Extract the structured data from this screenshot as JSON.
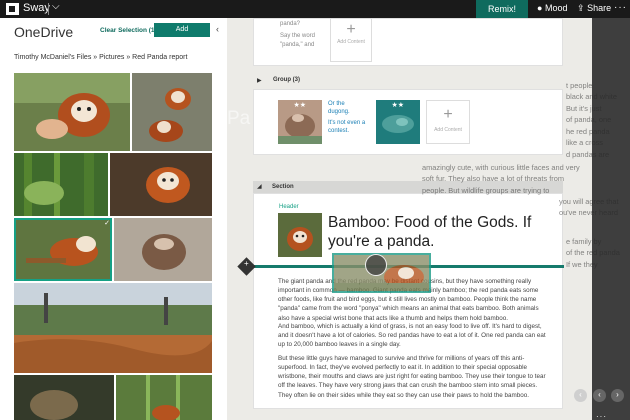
{
  "topbar": {
    "app_name": "Sway",
    "remix_label": "Remix!",
    "mood_label": "Mood",
    "share_label": "Share"
  },
  "onedrive": {
    "title": "OneDrive",
    "clear_selection": "Clear Selection (1)",
    "add_label": "Add",
    "breadcrumb": "Timothy McDaniel's Files » Pictures » Red Panda report"
  },
  "canvas": {
    "bg_text": "Pa",
    "prev_card_text_line1": "panda?",
    "prev_card_text_line2": "Say the word",
    "prev_card_text_line3": "\"panda,\" and",
    "add_content_label": "Add Content",
    "group_label": "Group (3)",
    "group_note_line1": "Or the",
    "group_note_line2": "dugong.",
    "group_note_line3": "It's not even a",
    "group_note_line4": "contest.",
    "section_label": "Section",
    "header_label": "Header",
    "heading": "Bamboo: Food of the Gods. If you're a panda.",
    "para1": "The giant panda and the red panda may be distant cousins, but they have something really important in common — bamboo. Giant panda eats mainly bamboo; the red panda eats some other foods, like fruit and bird eggs, but it still lives mostly on bamboo. People think the name \"panda\" came from the word \"ponya\" which means an animal that eats bamboo. Both animals also have a special wrist bone that acts like a thumb and helps them hold bamboo.",
    "para2": "And bamboo, which is actually a kind of grass, is not an easy food to live off. It's hard to digest, and it doesn't have a lot of calories. So red pandas have to eat a lot of it. One red panda can eat up to 20,000 bamboo leaves in a single day.",
    "para3": "But these little guys have managed to survive and thrive for millions of years off this anti-superfood. In fact, they've evolved perfectly to eat it. In addition to their special opposable wristbone, their mouths and claws are just right for eating bamboo. They use their tongue to tear off the leaves. They have very strong jaws that can crush the bamboo stem into small pieces. They often lie on their sides while they eat so they can use their paws to hold the bamboo."
  },
  "preview": {
    "line1": "t people",
    "line2": "black and white",
    "line3": "But it's just",
    "line4": "of panda, one",
    "line5": "he red panda",
    "line6": "like a cross",
    "line7": "d pandas are",
    "line8": "amazingly cute, with curious little faces and very",
    "line9": "soft fur. They also have a lot of threats from",
    "line10": "people. But wildlife groups are trying to",
    "line11": "you will agree that",
    "line12": "ou've never heard",
    "line13": "e family by",
    "line14": "of the red panda",
    "line15": "If we they"
  },
  "colors": {
    "accent": "#0f7b6c",
    "topbar": "#1a1a1a",
    "link_blue": "#1a7fb5"
  }
}
